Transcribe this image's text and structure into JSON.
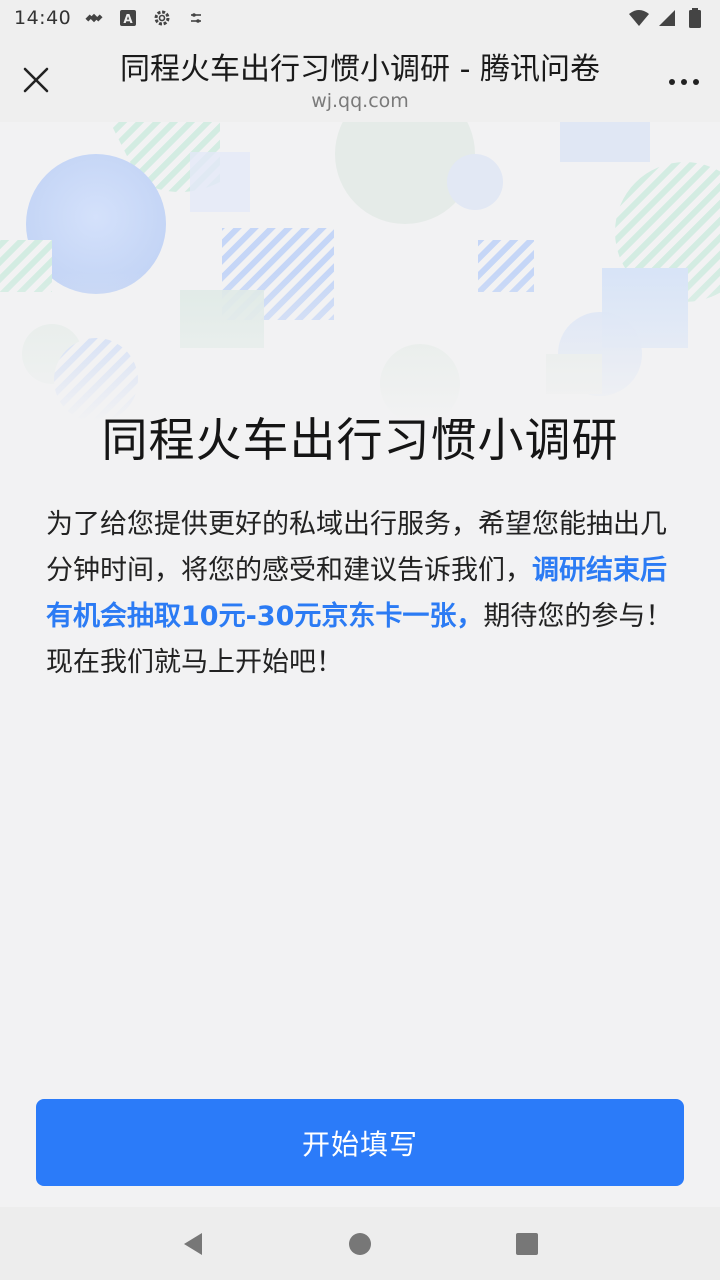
{
  "status": {
    "time": "14:40",
    "icons_left": [
      "satellite-icon",
      "accessibility-a-icon",
      "settings-gear-icon",
      "sliders-icon"
    ],
    "icons_right": [
      "wifi-icon",
      "signal-icon",
      "battery-icon"
    ]
  },
  "header": {
    "title": "同程火车出行习惯小调研 - 腾讯问卷",
    "url": "wj.qq.com"
  },
  "survey": {
    "title": "同程火车出行习惯小调研",
    "intro_part1": "为了给您提供更好的私域出行服务，希望您能抽出几分钟时间，将您的感受和建议告诉我们，",
    "intro_highlight": "调研结束后有机会抽取10元-30元京东卡一张，",
    "intro_part2": "期待您的参与！现在我们就马上开始吧！",
    "highlight_color": "#2b7bf4"
  },
  "actions": {
    "start_label": "开始填写",
    "button_color": "#2b7bf9"
  },
  "nav": {
    "back": "back-icon",
    "home": "home-icon",
    "recents": "recents-icon"
  }
}
